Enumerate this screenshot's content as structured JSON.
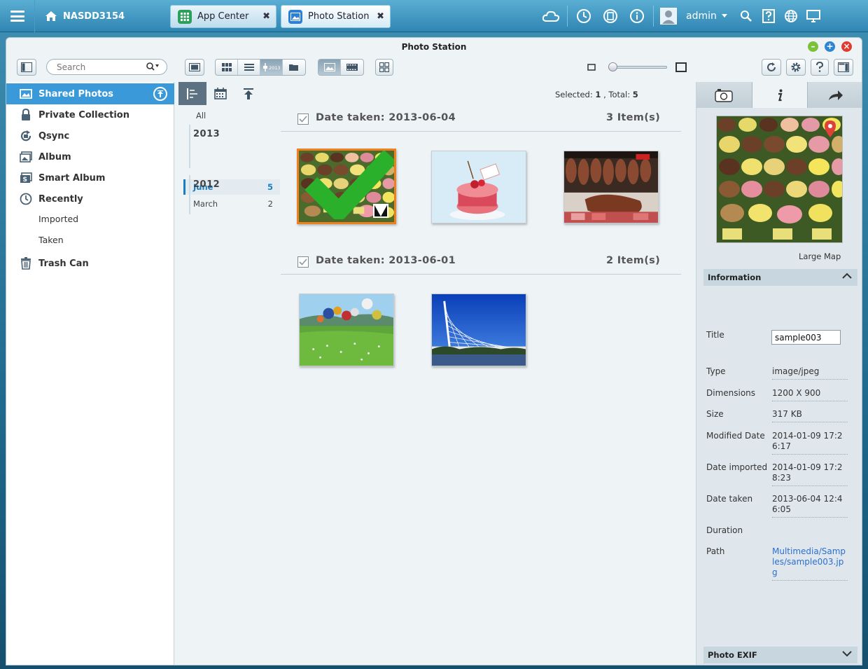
{
  "taskbar": {
    "home_label": "NASDD3154",
    "tabs": [
      {
        "label": "App Center",
        "close": "✖"
      },
      {
        "label": "Photo Station",
        "close": "✖"
      }
    ],
    "user": "admin"
  },
  "window": {
    "title": "Photo Station"
  },
  "toolbar": {
    "search_placeholder": "Search",
    "year_tag": "2013"
  },
  "sidebar": {
    "items": [
      {
        "label": "Shared Photos"
      },
      {
        "label": "Private Collection"
      },
      {
        "label": "Qsync"
      },
      {
        "label": "Album"
      },
      {
        "label": "Smart Album"
      },
      {
        "label": "Recently"
      },
      {
        "label": "Trash Can"
      }
    ],
    "recently_sub": [
      "Imported",
      "Taken"
    ]
  },
  "timeline": {
    "all": "All",
    "years": [
      {
        "year": "2013",
        "months": [
          {
            "name": "June",
            "count": "5"
          },
          {
            "name": "March",
            "count": "2"
          }
        ]
      },
      {
        "year": "2012",
        "months": []
      }
    ]
  },
  "status": {
    "selected_label": "Selected:",
    "selected": "1",
    "sep": ",",
    "total_label": "Total:",
    "total": "5"
  },
  "groups": [
    {
      "title": "Date taken: 2013-06-04",
      "count": "3 Item(s)"
    },
    {
      "title": "Date taken: 2013-06-01",
      "count": "2 Item(s)"
    }
  ],
  "right_panel": {
    "large_map": "Large Map",
    "info_header": "Information",
    "exif_header": "Photo EXIF",
    "fields": [
      {
        "label": "Title",
        "value": "sample003"
      },
      {
        "label": "Type",
        "value": "image/jpeg"
      },
      {
        "label": "Dimensions",
        "value": "1200 X 900"
      },
      {
        "label": "Size",
        "value": "317 KB"
      },
      {
        "label": "Modified Date",
        "value": "2014-01-09 17:26:17"
      },
      {
        "label": "Date imported",
        "value": "2014-01-09 17:28:23"
      },
      {
        "label": "Date taken",
        "value": "2013-06-04 12:46:05"
      },
      {
        "label": "Duration",
        "value": ""
      },
      {
        "label": "Path",
        "value": "Multimedia/Samples/sample003.jpg"
      }
    ]
  },
  "colors": {
    "accent": "#3a9ad9",
    "selection_border": "#f0801e",
    "taskbar": "#2f86b3"
  }
}
